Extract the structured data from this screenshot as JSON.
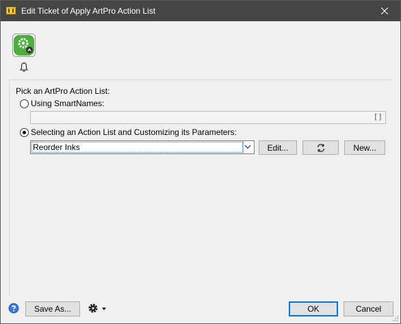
{
  "window": {
    "title": "Edit Ticket of Apply ArtPro Action List"
  },
  "form": {
    "heading": "Pick an ArtPro Action List:",
    "option_smartnames": "Using SmartNames:",
    "smartnames_value": "",
    "smartnames_bracket": "[]",
    "option_selecting": "Selecting an Action List and Customizing its Parameters:",
    "selected_action_list": "Reorder Inks",
    "selected_option": "selecting",
    "edit_label": "Edit...",
    "new_label": "New..."
  },
  "footer": {
    "save_as_label": "Save As...",
    "ok_label": "OK",
    "cancel_label": "Cancel"
  },
  "colors": {
    "titlebar": "#454545",
    "app_icon_green": "#4caf3c",
    "primary_border": "#0078d7",
    "help_blue": "#2b62b8"
  },
  "icons": {
    "title": "ticket-icon",
    "app": "action-list-gear-icon",
    "notify": "bell-icon",
    "refresh": "refresh-icon",
    "help": "help-icon",
    "settings": "gear-icon"
  }
}
